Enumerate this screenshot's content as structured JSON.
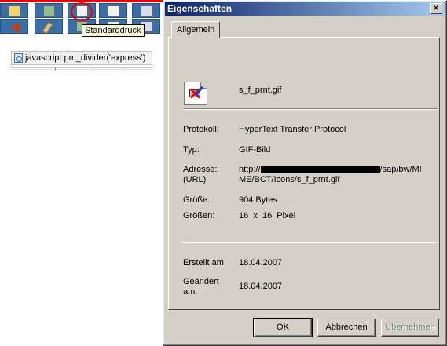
{
  "background": {
    "tooltip": "Standarddruck",
    "js_link": "javascript:pm_divider('express')"
  },
  "dialog": {
    "title": "Eigenschaften",
    "close_glyph": "×",
    "tab": "Allgemein",
    "file_name": "s_f_prnt.gif",
    "props": {
      "protocol_label": "Protokoll:",
      "protocol_value": "HyperText Transfer Protocol",
      "type_label": "Typ:",
      "type_value": "GIF-Bild",
      "address_label_1": "Adresse:",
      "address_label_2": "(URL)",
      "address_prefix": "http://",
      "address_suffix": "/sap/bw/MI",
      "address_line2": "ME/BCT/Icons/s_f_prnt.gif",
      "size_label": "Größe:",
      "size_value": "904 Bytes",
      "dims_label": "Größen:",
      "dims_value": "16  x  16  Pixel",
      "created_label": "Erstellt am:",
      "created_value": "18.04.2007",
      "modified_label_1": "Geändert",
      "modified_label_2": "am:",
      "modified_value": "18.04.2007"
    },
    "buttons": {
      "ok": "OK",
      "cancel": "Abbrechen",
      "apply": "Übernehmen"
    }
  },
  "colors": {
    "title_gradient_start": "#0a246a",
    "title_gradient_end": "#a6caf0",
    "dialog_face": "#d4d0c8",
    "toolbar_button": "#3a6ea5",
    "highlight": "#e00000",
    "tooltip_bg": "#ffffe1"
  }
}
